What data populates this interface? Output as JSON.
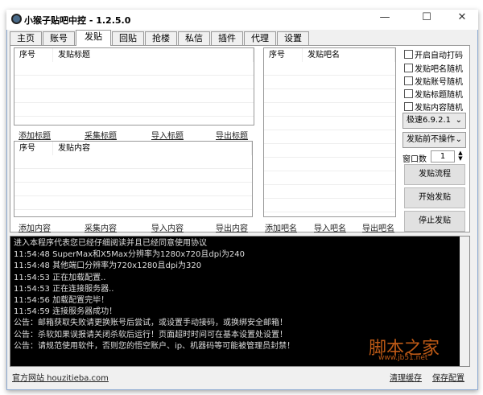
{
  "window": {
    "title": "小猴子贴吧中控 - 1.2.5.0",
    "minimize": "—",
    "maximize": "☐",
    "close": "✕"
  },
  "tabs": [
    "主页",
    "账号",
    "发贴",
    "回贴",
    "抢楼",
    "私信",
    "插件",
    "代理",
    "设置"
  ],
  "active_tab": "发贴",
  "title_list": {
    "col_index": "序号",
    "col_title": "发贴标题",
    "actions": [
      "添加标题",
      "采集标题",
      "导入标题",
      "导出标题"
    ]
  },
  "content_list": {
    "col_index": "序号",
    "col_content": "发贴内容",
    "actions": [
      "添加内容",
      "采集内容",
      "导入内容",
      "导出内容"
    ]
  },
  "bar_list": {
    "col_index": "序号",
    "col_name": "发贴吧名",
    "actions": [
      "添加吧名",
      "导入吧名",
      "导出吧名"
    ]
  },
  "options": {
    "checkboxes": [
      "开启自动打码",
      "发贴吧名随机",
      "发贴账号随机",
      "发贴标题随机",
      "发贴内容随机"
    ],
    "engine_select": "极速6.9.2.1",
    "before_post_select": "发贴前不操作",
    "window_count_label": "窗口数",
    "window_count": "1",
    "buttons": [
      "发贴流程",
      "开始发贴",
      "停止发贴"
    ]
  },
  "log": [
    "进入本程序代表您已经仔细阅读并且已经同意使用协议",
    "11:54:48 SuperMax和X5Max分辨率为1280x720且dpi为240",
    "11:54:48 其他端口分辨率为720x1280且dpi为320",
    "11:54:53 正在加载配置..",
    "11:54:53 正在连接服务器..",
    "11:54:56 加载配置完毕！",
    "11:54:59 连接服务器成功！",
    "公告：邮箱获取失败请更换账号后尝试，或设置手动接码，或换绑安全邮箱！",
    "公告：杀软如果误报请关闭杀软后运行！页面超时时间可在基本设置处设置！",
    "公告：请规范使用软件，否则您的悟空账户、ip、机器码等可能被管理员封禁！"
  ],
  "footer": {
    "website": "官方网站 houzitieba.com",
    "clear_cache": "清理缓存",
    "save_config": "保存配置"
  },
  "watermark": {
    "text": "脚本之家",
    "url": "www.jb51.net"
  }
}
